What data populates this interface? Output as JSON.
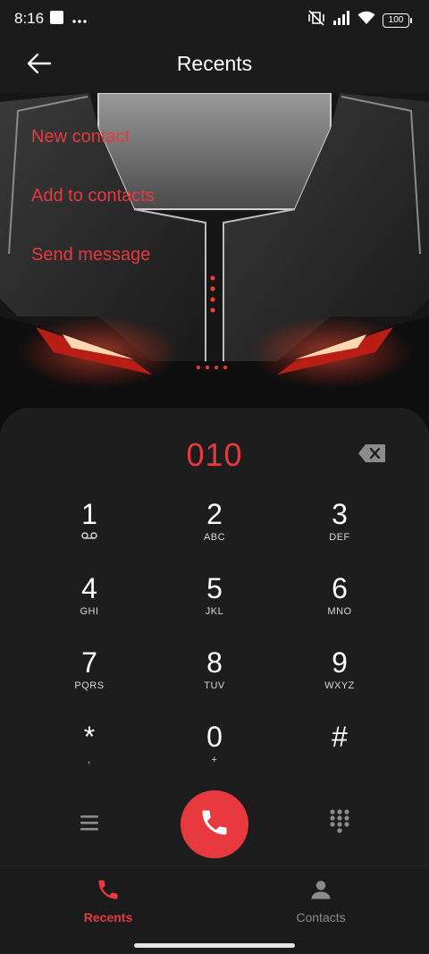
{
  "status_bar": {
    "time": "8:16",
    "battery": "100",
    "icons": [
      "image-notification-icon",
      "more-dots-icon",
      "vibrate-off-icon",
      "signal-icon",
      "wifi-icon",
      "battery-icon"
    ]
  },
  "header": {
    "title": "Recents",
    "back_icon": "back-arrow-icon"
  },
  "actions": [
    {
      "label": "New contact"
    },
    {
      "label": "Add to contacts"
    },
    {
      "label": "Send message"
    }
  ],
  "dialer": {
    "number": "010",
    "backspace_icon": "backspace-icon",
    "keys": [
      {
        "digit": "1",
        "letters": ""
      },
      {
        "digit": "2",
        "letters": "ABC"
      },
      {
        "digit": "3",
        "letters": "DEF"
      },
      {
        "digit": "4",
        "letters": "GHI"
      },
      {
        "digit": "5",
        "letters": "JKL"
      },
      {
        "digit": "6",
        "letters": "MNO"
      },
      {
        "digit": "7",
        "letters": "PQRS"
      },
      {
        "digit": "8",
        "letters": "TUV"
      },
      {
        "digit": "9",
        "letters": "WXYZ"
      },
      {
        "digit": "*",
        "letters": ","
      },
      {
        "digit": "0",
        "letters": "+"
      },
      {
        "digit": "#",
        "letters": ""
      }
    ],
    "voicemail_icon": "voicemail-icon",
    "menu_icon": "menu-icon",
    "call_icon": "phone-icon",
    "keypad_icon": "dialpad-icon"
  },
  "bottom_nav": {
    "tabs": [
      {
        "label": "Recents",
        "icon": "phone-icon",
        "active": true
      },
      {
        "label": "Contacts",
        "icon": "person-icon",
        "active": false
      }
    ]
  },
  "colors": {
    "accent": "#e8393f",
    "background": "#1b1b1b",
    "sheet": "#1d1d1d",
    "inactive": "#8a8a8a"
  }
}
